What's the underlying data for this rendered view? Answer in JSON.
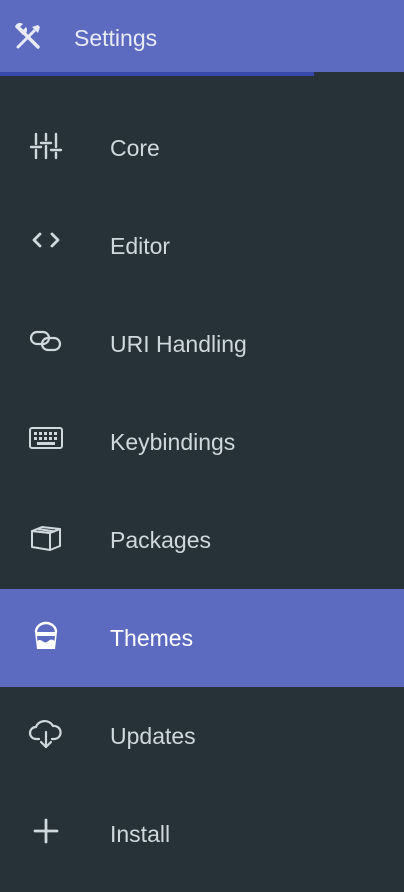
{
  "header": {
    "title": "Settings",
    "icon": "tools-icon"
  },
  "colors": {
    "background": "#263238",
    "accent": "#5c6bc0",
    "accent_dark": "#3949ab",
    "text": "#cfd8dc",
    "active_text": "#ffffff"
  },
  "menu": {
    "active_index": 5,
    "items": [
      {
        "label": "Core",
        "icon": "sliders-icon"
      },
      {
        "label": "Editor",
        "icon": "code-icon"
      },
      {
        "label": "URI Handling",
        "icon": "link-icon"
      },
      {
        "label": "Keybindings",
        "icon": "keyboard-icon"
      },
      {
        "label": "Packages",
        "icon": "package-icon"
      },
      {
        "label": "Themes",
        "icon": "paint-bucket-icon"
      },
      {
        "label": "Updates",
        "icon": "cloud-download-icon"
      },
      {
        "label": "Install",
        "icon": "plus-icon"
      }
    ]
  }
}
